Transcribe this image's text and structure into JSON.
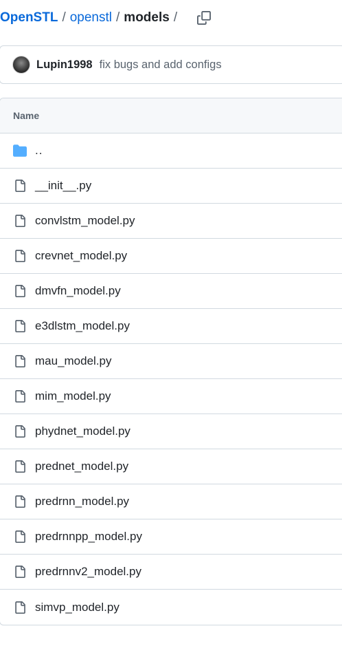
{
  "breadcrumb": {
    "owner": "OpenSTL",
    "repo": "openstl",
    "folder": "models",
    "separator": "/",
    "copy_icon": "copy-icon"
  },
  "latest_commit": {
    "author": "Lupin1998",
    "message": "fix bugs and add configs",
    "avatar_icon": "avatar"
  },
  "file_table": {
    "header": "Name",
    "parent": "..",
    "files": [
      "__init__.py",
      "convlstm_model.py",
      "crevnet_model.py",
      "dmvfn_model.py",
      "e3dlstm_model.py",
      "mau_model.py",
      "mim_model.py",
      "phydnet_model.py",
      "prednet_model.py",
      "predrnn_model.py",
      "predrnnpp_model.py",
      "predrnnv2_model.py",
      "simvp_model.py"
    ]
  },
  "colors": {
    "link": "#0969da",
    "folder_icon": "#54aeff",
    "border": "#d1d9e0",
    "muted_text": "#59636e",
    "header_bg": "#f6f8fa"
  }
}
